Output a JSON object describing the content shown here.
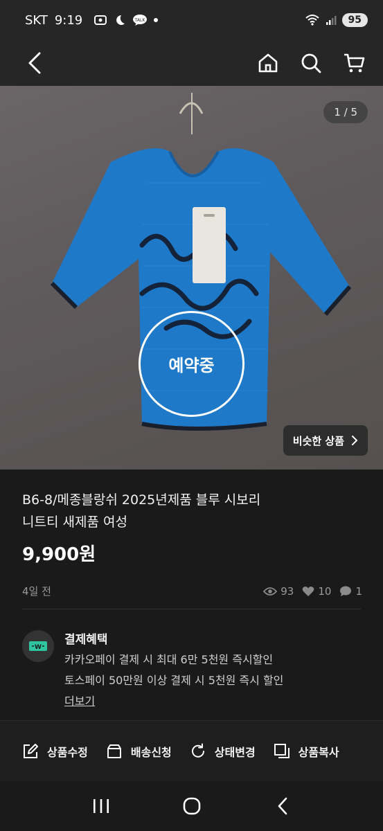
{
  "status_bar": {
    "carrier": "SKT",
    "time": "9:19",
    "battery": "95"
  },
  "photo": {
    "counter": "1 / 5",
    "reserved_label": "예약중",
    "similar_label": "비슷한 상품"
  },
  "product": {
    "title_line1": "B6-8/메종블랑쉬 2025년제품 블루 시보리",
    "title_line2": "니트티 새제품 여성",
    "price": "9,900원",
    "posted": "4일 전",
    "views": "93",
    "likes": "10",
    "chats": "1"
  },
  "benefit": {
    "title": "결제혜택",
    "line1": "카카오페이 결제 시 최대 6만 5천원 즉시할인",
    "line2": "토스페이 50만원 이상 결제 시 5천원 즉시 할인",
    "more": "더보기"
  },
  "actions": {
    "edit": "상품수정",
    "shipping": "배송신청",
    "status": "상태변경",
    "copy": "상품복사"
  },
  "colors": {
    "background": "#1a1a1a",
    "shirt": "#1e78c8",
    "accent_badge": "#2ec4a0"
  }
}
